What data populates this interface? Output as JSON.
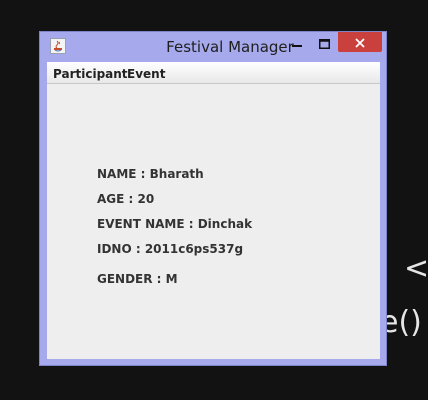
{
  "background": {
    "glyph_1": "<",
    "glyph_2": "e()"
  },
  "window": {
    "title": "Festival Manager",
    "controls": {
      "minimize": "—",
      "maximize": "☐",
      "close": "✕"
    }
  },
  "menubar": {
    "items": [
      {
        "label": "Participant"
      },
      {
        "label": "Event"
      }
    ]
  },
  "participant": {
    "name_line": "NAME : Bharath",
    "age_line": "AGE : 20",
    "event_line": "EVENT NAME : Dinchak",
    "id_line": "IDNO : 2011c6ps537g",
    "gender_line": "GENDER : M"
  },
  "colors": {
    "window_frame": "#a6aaed",
    "close_button": "#c9403c",
    "content_bg": "#eeeeee"
  },
  "icons": {
    "app": "java-app-icon"
  }
}
